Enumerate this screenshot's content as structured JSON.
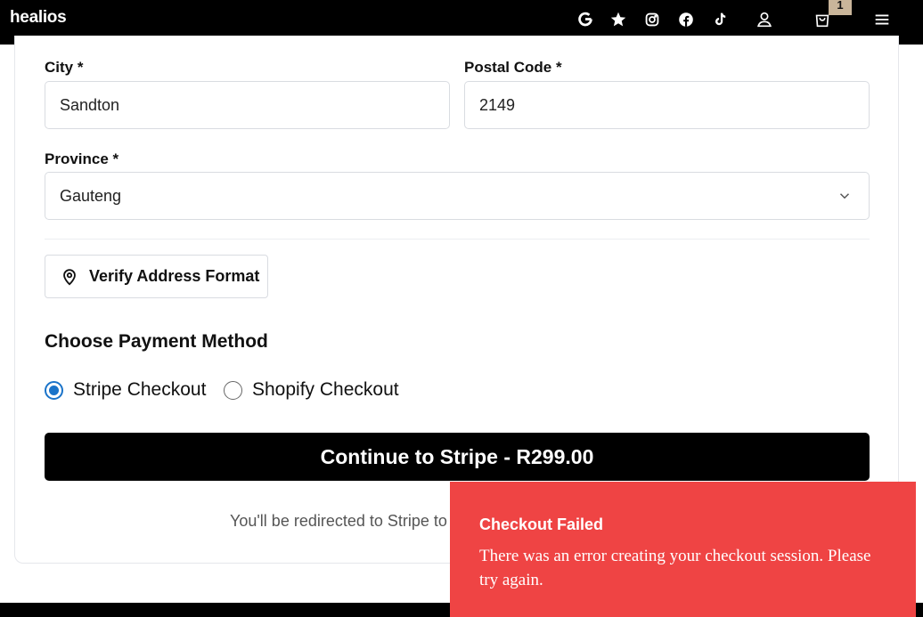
{
  "header": {
    "logo": "healios",
    "cart_count": "1",
    "icons": [
      "google-icon",
      "star-icon",
      "instagram-icon",
      "facebook-icon",
      "tiktok-icon",
      "user-icon",
      "cart-icon",
      "menu-icon"
    ]
  },
  "form": {
    "city_label": "City *",
    "city_value": "Sandton",
    "postal_label": "Postal Code *",
    "postal_value": "2149",
    "province_label": "Province *",
    "province_value": "Gauteng",
    "verify_label": "Verify Address Format"
  },
  "payment": {
    "title": "Choose Payment Method",
    "options": [
      {
        "label": "Stripe Checkout",
        "selected": true
      },
      {
        "label": "Shopify Checkout",
        "selected": false
      }
    ],
    "continue_label": "Continue to Stripe - R299.00",
    "redirect_note": "You'll be redirected to Stripe to"
  },
  "toast": {
    "title": "Checkout Failed",
    "message": "There was an error creating your checkout session. Please try again.",
    "color": "#ef4444"
  },
  "colors": {
    "header_bg": "#000000",
    "radio_accent": "#1a73c9",
    "badge": "#c9b59a"
  }
}
